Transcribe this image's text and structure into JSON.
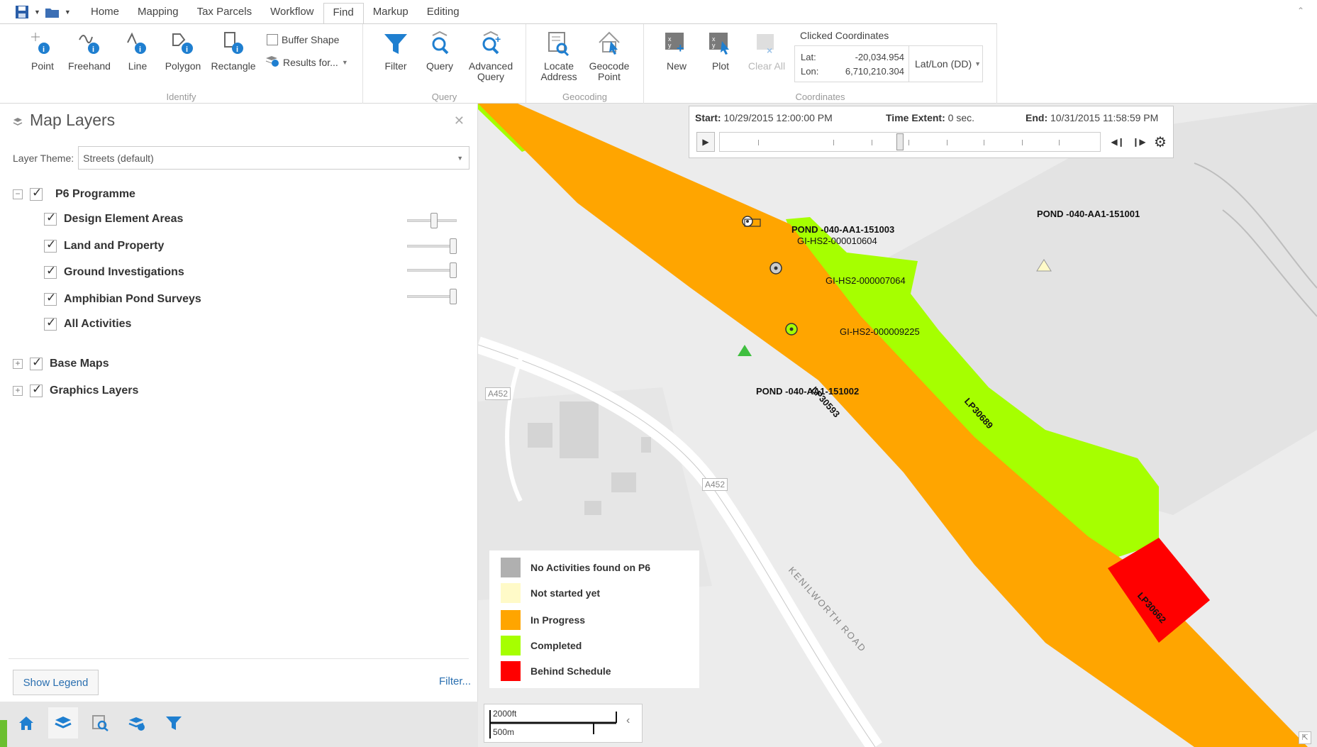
{
  "tabs": [
    "Home",
    "Mapping",
    "Tax Parcels",
    "Workflow",
    "Find",
    "Markup",
    "Editing"
  ],
  "active_tab": "Find",
  "identify": {
    "label": "Identify",
    "tools": [
      "Point",
      "Freehand",
      "Line",
      "Polygon",
      "Rectangle"
    ],
    "buffer_shape": "Buffer Shape",
    "results_for": "Results for..."
  },
  "query": {
    "label": "Query",
    "tools": [
      "Filter",
      "Query",
      "Advanced Query"
    ]
  },
  "geocoding": {
    "label": "Geocoding",
    "tools": [
      "Locate Address",
      "Geocode Point"
    ]
  },
  "coordinates": {
    "label": "Coordinates",
    "tools": [
      "New",
      "Plot",
      "Clear All"
    ],
    "title": "Clicked Coordinates",
    "lat_label": "Lat:",
    "lon_label": "Lon:",
    "lat_value": "-20,034.954",
    "lon_value": "6,710,210.304",
    "format": "Lat/Lon (DD)"
  },
  "panel": {
    "title": "Map Layers",
    "theme_label": "Layer Theme:",
    "theme_value": "Streets (default)",
    "groups": [
      {
        "label": "P6 Programme",
        "expander": "−"
      },
      {
        "label": "Base Maps",
        "expander": "+"
      },
      {
        "label": "Graphics Layers",
        "expander": "+"
      }
    ],
    "layers": [
      {
        "label": "Design Element Areas",
        "opacity": 0.55
      },
      {
        "label": "Land and Property",
        "opacity": 1.0
      },
      {
        "label": "Ground Investigations",
        "opacity": 1.0
      },
      {
        "label": "Amphibian Pond Surveys",
        "opacity": 1.0
      },
      {
        "label": "All Activities"
      }
    ],
    "show_legend": "Show Legend",
    "filter_link": "Filter..."
  },
  "time_slider": {
    "start_label": "Start:",
    "start_value": "10/29/2015 12:00:00 PM",
    "extent_label": "Time Extent:",
    "extent_value": "0 sec.",
    "end_label": "End:",
    "end_value": "10/31/2015 11:58:59 PM",
    "position": 0.47
  },
  "legend": [
    {
      "label": "No Activities found on P6",
      "color": "#b0b0b0"
    },
    {
      "label": "Not started yet",
      "color": "#fffac8"
    },
    {
      "label": "In Progress",
      "color": "#ffa500"
    },
    {
      "label": "Completed",
      "color": "#a6ff00"
    },
    {
      "label": "Behind Schedule",
      "color": "#ff0000"
    }
  ],
  "map_labels": {
    "pond1": "POND -040-AA1-151003",
    "gi1": "GI-HS2-000010604",
    "gi2": "GI-HS2-000007064",
    "gi3": "GI-HS2-000009225",
    "pond2": "POND -040-AA1-151002",
    "pond3": "POND -040-AA1-151001",
    "lp1": "LP30593",
    "lp2": "LP30689",
    "lp3": "LP30662",
    "road1": "A452",
    "road2": "A452",
    "road_name": "KENILWORTH ROAD"
  },
  "scale": {
    "imperial": "2000ft",
    "metric": "500m"
  },
  "colors": {
    "accent": "#2a6fb0",
    "progress": "#ffa500",
    "completed": "#a6ff00",
    "behind": "#ff0000"
  }
}
